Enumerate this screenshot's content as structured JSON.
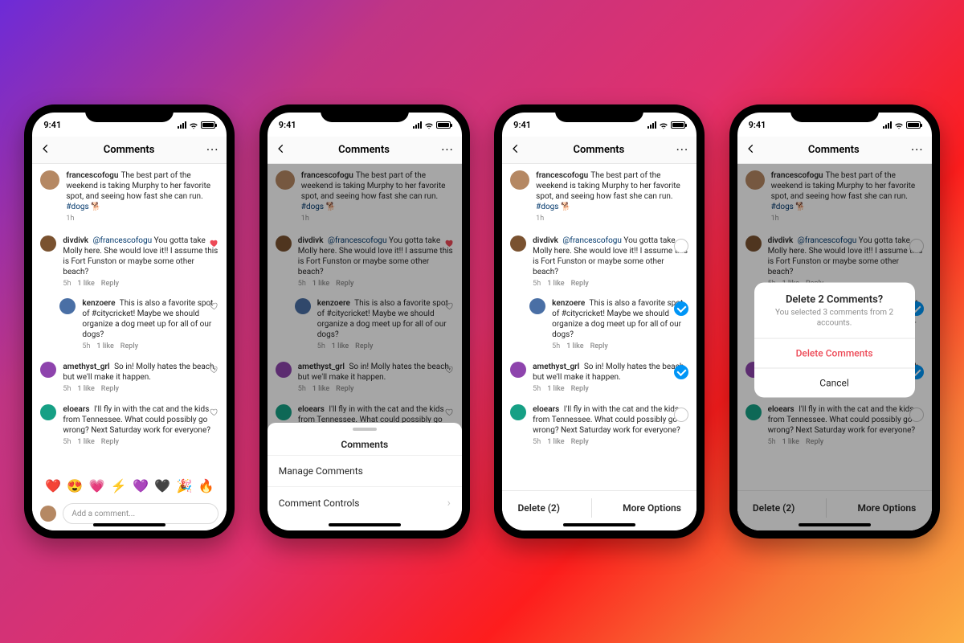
{
  "status": {
    "time": "9:41"
  },
  "nav": {
    "title": "Comments"
  },
  "post": {
    "user": "francescofogu",
    "text": "The best part of the weekend is taking Murphy to her favorite spot, and seeing how fast she can run. ",
    "hashtag": "#dogs",
    "emoji": "🐕",
    "time": "1h"
  },
  "comments": [
    {
      "user": "divdivk",
      "mention": "@francescofogu",
      "text": " You gotta take Molly here. She would love it!! I assume this is Fort Funston or maybe some other beach?",
      "time": "5h",
      "likes": "1 like",
      "reply_label": "Reply",
      "liked": true,
      "reply": false
    },
    {
      "user": "kenzoere",
      "mention": "",
      "text": "This is also a favorite spot of #citycricket! Maybe we should organize a dog meet up for all of our dogs?",
      "time": "5h",
      "likes": "1 like",
      "reply_label": "Reply",
      "liked": false,
      "reply": true
    },
    {
      "user": "amethyst_grl",
      "mention": "",
      "text": "So in! Molly hates the beach, but we'll make it happen.",
      "time": "5h",
      "likes": "1 like",
      "reply_label": "Reply",
      "liked": false,
      "reply": false
    },
    {
      "user": "eloears",
      "mention": "",
      "text": "I'll fly in with the cat and the kids from Tennessee. What could possibly go wrong? Next Saturday work for everyone?",
      "time": "5h",
      "likes": "1 like",
      "reply_label": "Reply",
      "liked": false,
      "reply": false
    }
  ],
  "composer": {
    "emoji": [
      "❤️",
      "😍",
      "💗",
      "⚡",
      "💜",
      "🖤",
      "🎉",
      "🔥"
    ],
    "placeholder": "Add a comment..."
  },
  "sheet": {
    "title": "Comments",
    "item1": "Manage Comments",
    "item2": "Comment Controls"
  },
  "select_actions": {
    "delete": "Delete (2)",
    "more": "More Options"
  },
  "alert": {
    "title": "Delete 2 Comments?",
    "subtitle": "You selected 3 comments from 2 accounts.",
    "destructive": "Delete Comments",
    "cancel": "Cancel"
  },
  "selection": [
    false,
    true,
    true,
    false
  ]
}
